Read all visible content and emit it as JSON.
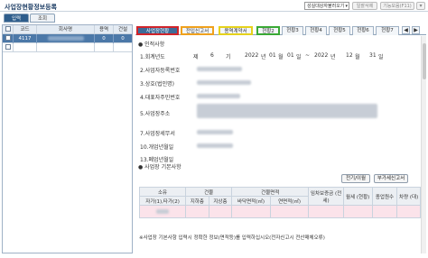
{
  "window": {
    "title": "사업장현황정보등록"
  },
  "topbar": {
    "dropdown": "성실대상자불러오기",
    "btn_delete": "일괄삭제",
    "btn_function": "기능모음(F11)"
  },
  "mode_tabs": {
    "input": "입력",
    "view": "조회"
  },
  "left_table": {
    "headers": [
      "코드",
      "회사명",
      "용역",
      "건설"
    ],
    "rows": [
      {
        "code": "4117",
        "service": "0",
        "construction": "0"
      }
    ]
  },
  "tabs": [
    "사업장현황",
    "전입신고서",
    "용역계약서",
    "현황2",
    "현황3",
    "현황4",
    "현황5",
    "현황6",
    "현황7"
  ],
  "nav": {
    "left": "◀",
    "right": "▶"
  },
  "form": {
    "section_title": "● 인적사항",
    "fields": {
      "f1": "1.회계년도",
      "f2": "2.사업자등록번호",
      "f3": "3.상호(법인명)",
      "f4": "4.대표자주민번호",
      "f5": "5.사업장주소",
      "f6": "7.사업장세무서",
      "f7": "10.개업년월일",
      "f8": "13.폐업년월일"
    },
    "fiscal": {
      "term_no": "제",
      "term": "6",
      "term_unit": "기",
      "start_year": "2022",
      "start_month": "01",
      "start_day": "01",
      "sep": "~",
      "end_year": "2022",
      "end_month": "12",
      "end_day": "31",
      "unit_year": "년",
      "unit_month": "월",
      "unit_day": "일"
    },
    "section2_title": "● 사업장 기본사항"
  },
  "buttons": {
    "electronic": "전기/이월",
    "attach": "부가세신고서"
  },
  "building_table": {
    "row1": [
      "소유",
      "건물",
      "",
      "건물면적",
      "",
      "임차보증금 (전세)",
      "월세 (현황)",
      "종업원수",
      "차량 (대)"
    ],
    "row2": [
      "자가(1),타가(2)",
      "지하층",
      "지상층",
      "바닥면적(㎡)",
      "연면적(㎡)",
      "",
      "",
      "",
      ""
    ],
    "row3": [
      "",
      "",
      "",
      "",
      "",
      "",
      "",
      "",
      ""
    ]
  },
  "footer_note": "※사업장 기본사항 입력시 정확한 정보(면적등)를 입력하십시오(전자신고시 전산매체오류)"
}
